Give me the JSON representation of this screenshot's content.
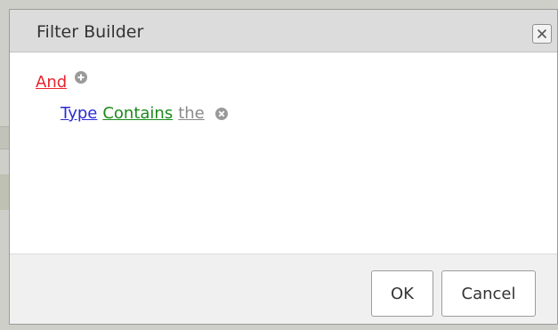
{
  "dialog": {
    "title": "Filter Builder",
    "close_icon": "close-icon"
  },
  "filter": {
    "group_operator": "And",
    "add_icon": "plus-circle-icon",
    "conditions": [
      {
        "field": "Type",
        "operator": "Contains",
        "value": "the",
        "remove_icon": "x-circle-icon"
      }
    ]
  },
  "footer": {
    "ok_label": "OK",
    "cancel_label": "Cancel"
  },
  "colors": {
    "group_operator": "#e8242e",
    "field": "#2b2bd6",
    "condition_operator": "#1a8a1a",
    "value": "#8a8a8a"
  }
}
